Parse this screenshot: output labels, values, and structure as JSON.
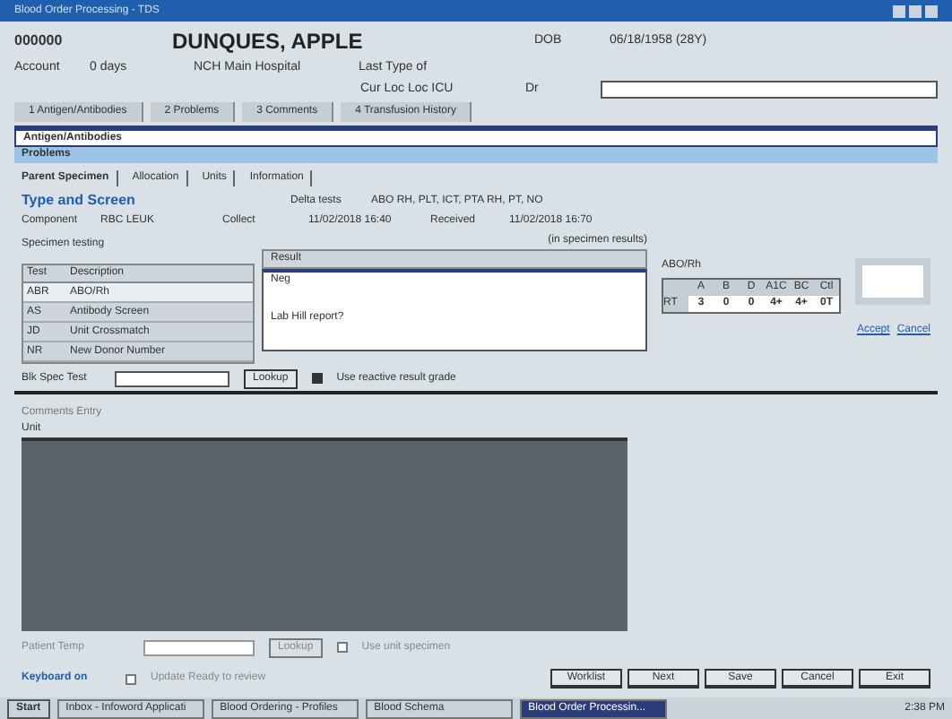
{
  "window": {
    "title": "Blood Order Processing - TDS"
  },
  "header": {
    "mrn": "000000",
    "patient": "DUNQUES, APPLE",
    "sex_label": "DOB",
    "dob": "06/18/1958 (28Y)",
    "account_label": "Account",
    "account": "0 days",
    "location": "NCH Main Hospital",
    "last_label": "Last Type of",
    "loc_label": "Cur Loc Loc ICU",
    "dr_label": "Dr"
  },
  "tabs": [
    {
      "label": "1 Antigen/Antibodies",
      "selected": false
    },
    {
      "label": "2 Problems",
      "selected": false
    },
    {
      "label": "3 Comments",
      "selected": false
    },
    {
      "label": "4 Transfusion History",
      "selected": false
    }
  ],
  "info_lines": [
    {
      "text": "Antigen/Antibodies",
      "kind": "field"
    },
    {
      "text": "Problems",
      "kind": "band"
    }
  ],
  "subtabs": [
    {
      "label": "Parent Specimen",
      "selected": true
    },
    {
      "label": "Allocation",
      "selected": false
    },
    {
      "label": "Units",
      "selected": false
    },
    {
      "label": "Information",
      "selected": false
    }
  ],
  "section": {
    "title": "Type and Screen",
    "codes_label": "Delta tests",
    "codes": "ABO RH, PLT, ICT, PTA RH, PT, NO",
    "component_label": "Component",
    "component": "RBC LEUK",
    "collect_label": "Collect",
    "collect": "11/02/2018 16:40",
    "received_label": "Received",
    "received": "11/02/2018 16:70"
  },
  "specimen": {
    "title": "Specimen testing",
    "link": "(in specimen results)",
    "columns": [
      "Test",
      "Description"
    ],
    "rows": [
      {
        "test": "ABR",
        "description": "ABO/Rh",
        "selected": true
      },
      {
        "test": "AS",
        "description": "Antibody Screen",
        "selected": false
      },
      {
        "test": "JD",
        "description": "Unit Crossmatch",
        "selected": false
      },
      {
        "test": "NR",
        "description": "New Donor Number",
        "selected": false
      }
    ]
  },
  "result": {
    "header": "Result",
    "items": [
      "Neg",
      "Lab Hill report?"
    ]
  },
  "abo": {
    "title": "ABO/Rh",
    "columns": [
      "A",
      "B",
      "D",
      "A1C",
      "BC",
      "Ctl"
    ],
    "row_label": "RT",
    "cells": [
      "3",
      "0",
      "0",
      "4+",
      "4+",
      "0T"
    ]
  },
  "side_panel": {
    "accept": "Accept",
    "cancel": "Cancel"
  },
  "blood_type": {
    "label": "Blk Spec Test",
    "button": "Lookup",
    "checkbox_label": "Use reactive result grade",
    "checked": true
  },
  "comments": {
    "tab": "Comments Entry",
    "label": "Unit"
  },
  "bottom": {
    "label": "Patient Temp",
    "button": "Lookup",
    "checkbox_label": "Use unit specimen",
    "checked": false,
    "link": "Keyboard on",
    "check2_label": "Update Ready to review",
    "check2": false,
    "buttons": [
      "Worklist",
      "Next",
      "Save",
      "Cancel",
      "Exit"
    ]
  },
  "taskbar": {
    "start": "Start",
    "items": [
      {
        "label": "Inbox - Infoword Applicati",
        "selected": false
      },
      {
        "label": "Blood Ordering - Profiles",
        "selected": false
      },
      {
        "label": "Blood Schema",
        "selected": false
      },
      {
        "label": "Blood Order Processin...",
        "selected": true
      }
    ],
    "clock": "2:38 PM"
  }
}
